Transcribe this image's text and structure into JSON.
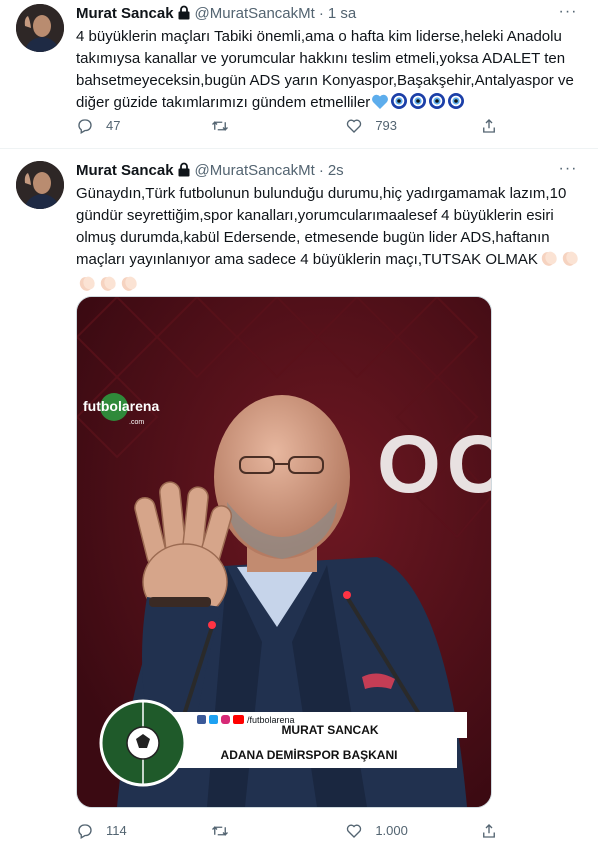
{
  "tweets": [
    {
      "author": {
        "name": "Murat Sancak",
        "handle": "@MuratSancakMt"
      },
      "separator": "·",
      "time": "1 sa",
      "more": "···",
      "lines": [
        "4 büyüklerin maçları Tabiki önemli,ama o hafta kim liderse,heleki Anadolu",
        "takımıysa kanallar ve yorumcular hakkını teslim etmeli,yoksa ADALET ten",
        "bahsetmeyeceksin,bugün ADS yarın Konyaspor,Başakşehir,Antalyaspor ve",
        "diğer güzide takımlarımızı gündem etmelliler"
      ],
      "emojis": [
        "blue-heart-icon",
        "nazar-icon",
        "nazar-icon",
        "nazar-icon",
        "nazar-icon"
      ],
      "actions": {
        "replies": "47",
        "retweets": "",
        "likes": "793",
        "share": ""
      }
    },
    {
      "author": {
        "name": "Murat Sancak",
        "handle": "@MuratSancakMt"
      },
      "separator": "·",
      "time": "2s",
      "more": "···",
      "lines": [
        "Günaydın,Türk futbolunun bulunduğu durumu,hiç yadırgamamak lazım,10",
        "gündür seyrettiğim,spor kanalları,yorumcularımaalesef 4 büyüklerin esiri",
        "olmuş durumda,kabül Edersende, etmesende bugün lider ADS,haftanın",
        "maçları yayınlanıyor ama sadece 4 büyüklerin maçı,TUTSAK OLMAK"
      ],
      "media": {
        "logo": "futbolarena",
        "logo_sub": ".com",
        "bg_text": "OC",
        "social_handle": "/futbolarena",
        "caption_name": "MURAT SANCAK",
        "caption_title": "ADANA DEMİRSPOR BAŞKANI"
      },
      "actions": {
        "replies": "114",
        "retweets": "",
        "likes": "1.000",
        "share": ""
      }
    }
  ]
}
